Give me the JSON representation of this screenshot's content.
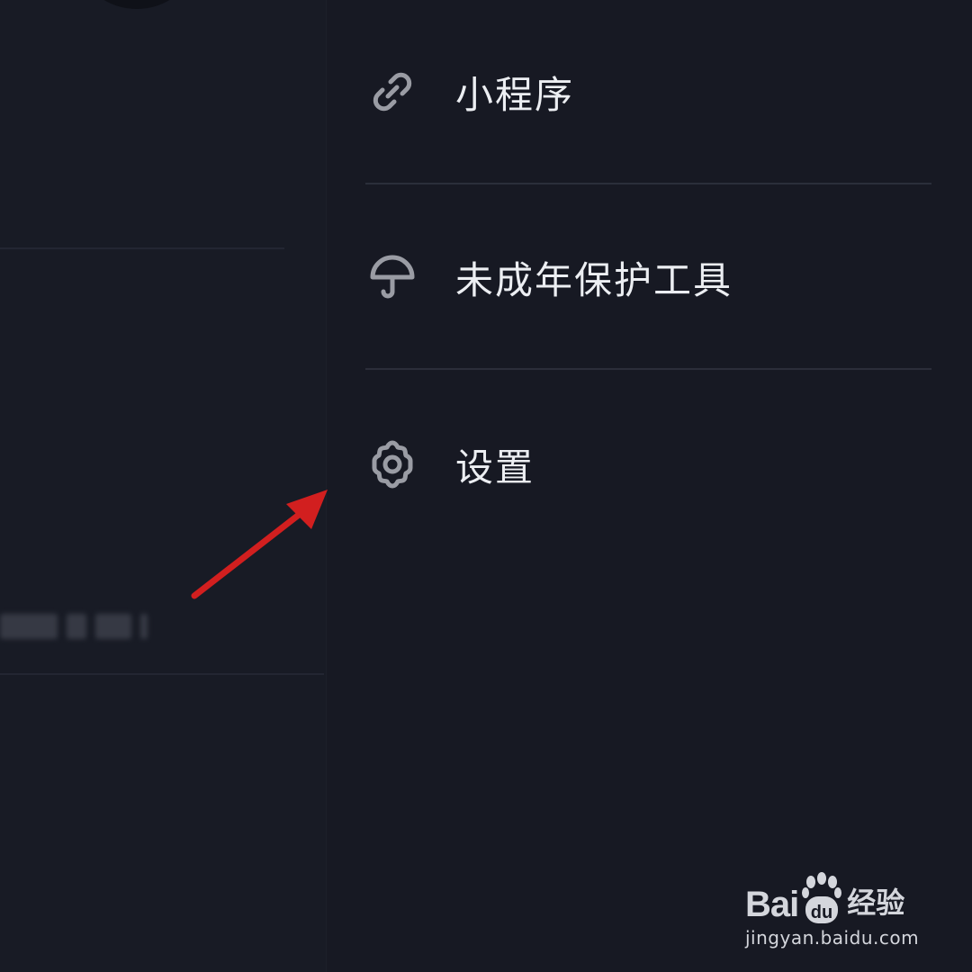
{
  "menu": {
    "items": [
      {
        "label": "小程序",
        "icon": "link-icon"
      },
      {
        "label": "未成年保护工具",
        "icon": "umbrella-icon"
      },
      {
        "label": "设置",
        "icon": "gear-icon"
      }
    ]
  },
  "left_panel": {
    "obscured_text": "blurred"
  },
  "watermark": {
    "brand_latin": "Bai",
    "brand_paw_text": "du",
    "brand_cn": "经验",
    "url": "jingyan.baidu.com"
  },
  "colors": {
    "background": "#171923",
    "text": "#eceef2",
    "icon": "#9a9ca4",
    "divider": "#2b2e3a",
    "annotation": "#d21f1f"
  }
}
